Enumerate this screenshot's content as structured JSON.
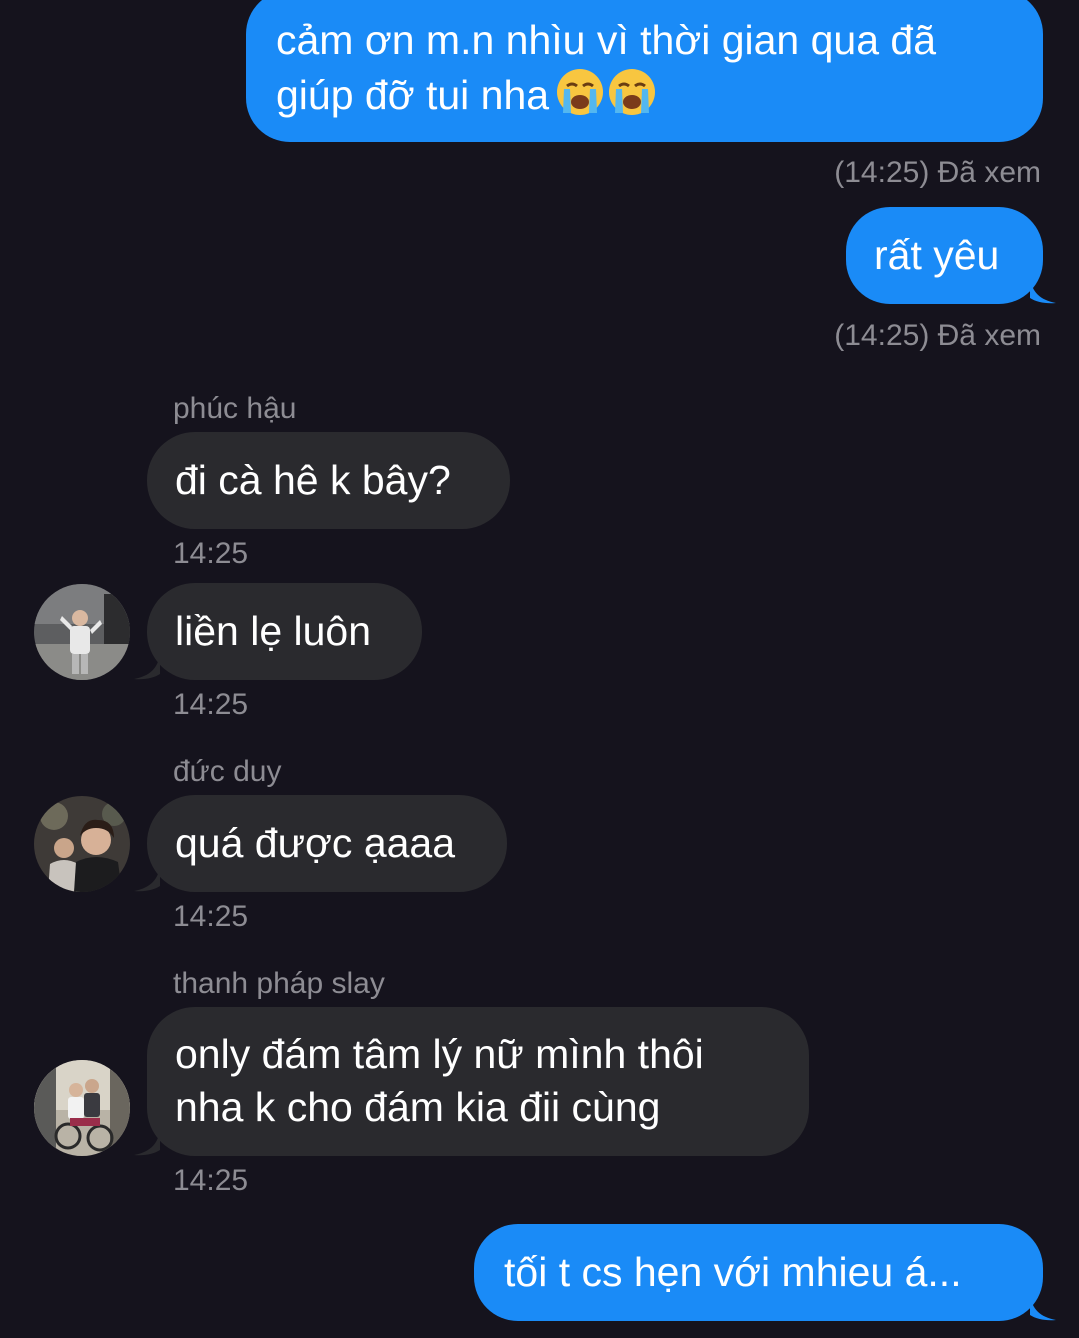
{
  "messages": {
    "m1": {
      "line1": "cảm ơn m.n nhìu vì thời gian qua đã",
      "line2": "giúp đỡ tui nha",
      "emoji": "loudly-crying-face-icon",
      "receipt": "(14:25) Đã xem"
    },
    "m2": {
      "text": "rất yêu",
      "receipt": "(14:25) Đã xem"
    },
    "m3": {
      "sender": "phúc hậu",
      "text": "đi cà hê k bây?",
      "time": "14:25"
    },
    "m4": {
      "text": "liền lẹ luôn",
      "time": "14:25"
    },
    "m5": {
      "sender": "đức duy",
      "text": "quá được ạaaa",
      "time": "14:25"
    },
    "m6": {
      "sender": "thanh pháp slay",
      "line1": "only đám tâm lý nữ mình thôi",
      "line2": "nha k cho đám kia đii cùng",
      "time": "14:25"
    },
    "m7": {
      "text": "tối t cs hẹn với mhieu á..."
    }
  },
  "colors": {
    "background": "#15131d",
    "outgoing_bubble": "#1a8bf7",
    "incoming_bubble": "#2a2a2e",
    "meta_text": "#8d8c93"
  }
}
